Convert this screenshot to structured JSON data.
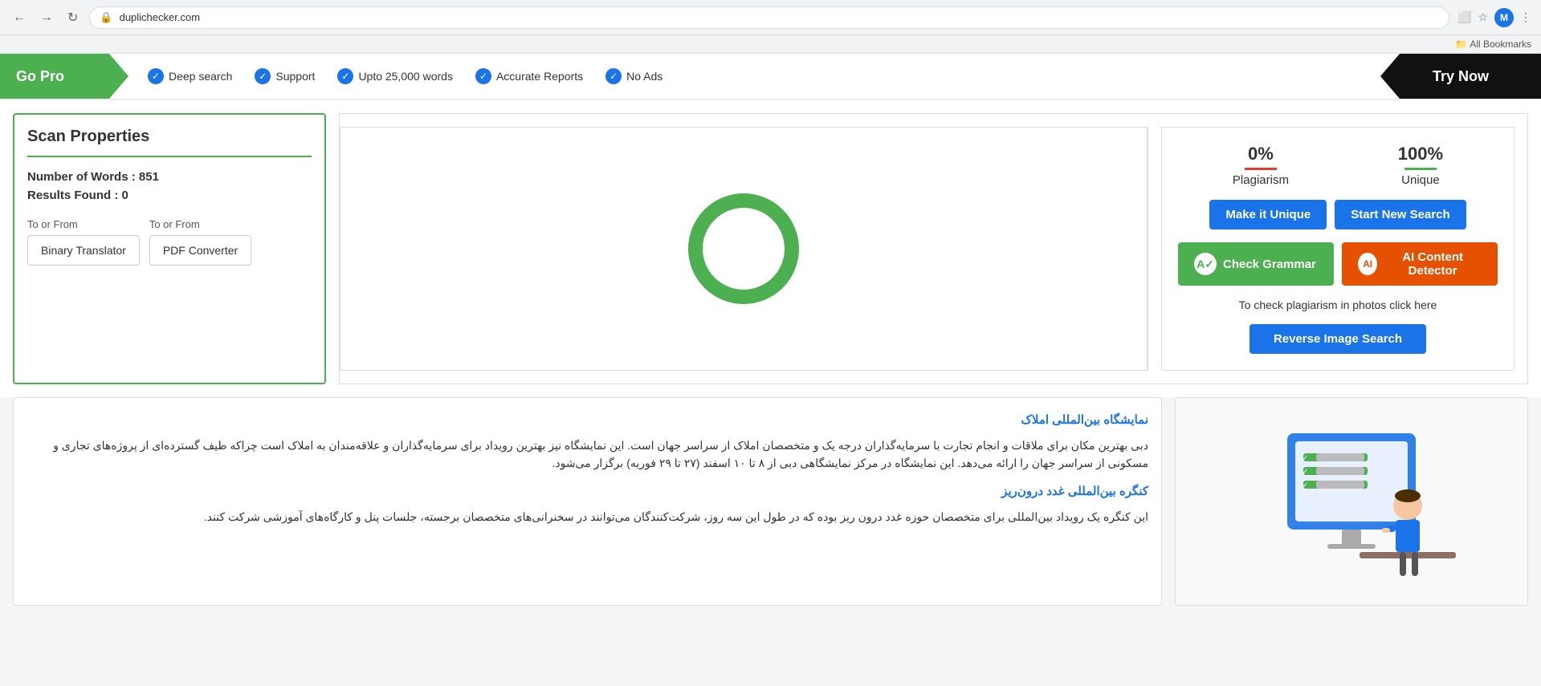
{
  "browser": {
    "url": "duplichecker.com",
    "bookmarks_bar": "All Bookmarks",
    "avatar_initial": "M"
  },
  "go_pro_banner": {
    "label": "Go Pro",
    "features": [
      {
        "icon": "check",
        "text": "Deep search"
      },
      {
        "icon": "check",
        "text": "Support"
      },
      {
        "icon": "check",
        "text": "Upto 25,000 words"
      },
      {
        "icon": "check",
        "text": "Accurate Reports"
      },
      {
        "icon": "check",
        "text": "No Ads"
      }
    ],
    "cta": "Try Now"
  },
  "scan_properties": {
    "title": "Scan Properties",
    "number_of_words_label": "Number of Words : ",
    "number_of_words_value": "851",
    "results_found_label": "Results Found : ",
    "results_found_value": "0",
    "converter1_label": "To or From",
    "converter1_text": "Binary Translator",
    "converter2_label": "To or From",
    "converter2_text": "PDF Converter"
  },
  "donut_chart": {
    "plagiarism_percent": 0,
    "unique_percent": 100,
    "stroke_color": "#4caf50",
    "track_color": "#e8e8e8"
  },
  "results_panel": {
    "plagiarism_percent": "0%",
    "plagiarism_label": "Plagiarism",
    "unique_percent": "100%",
    "unique_label": "Unique",
    "make_unique_label": "Make it Unique",
    "start_new_search_label": "Start New Search",
    "check_grammar_label": "Check Grammar",
    "ai_detector_label": "AI Content Detector",
    "plagiarism_photo_text": "To check plagiarism in photos click here",
    "reverse_image_search_label": "Reverse Image Search"
  },
  "text_content": {
    "section1_title": "نمایشگاه بین‌المللی املاک",
    "section1_body": "دبی بهترین مکان برای ملاقات و انجام تجارت با سرمایه‌گذاران درجه یک و متخصصان املاک از سراسر جهان است. این نمایشگاه نیز بهترین رویداد برای سرمایه‌گذاران و علاقه‌مندان به املاک است چراکه طیف گسترده‌ای از پروژه‌های تجاری و مسکونی از سراسر جهان را ارائه می‌دهد. این نمایشگاه در مرکز نمایشگاهی دبی از ۸ تا ۱۰ اسفند (۲۷ تا ۲۹ فوریه) برگزار می‌شود.",
    "section2_title": "کنگره بین‌المللی غدد درون‌ریز",
    "section2_body": "این کنگره یک رویداد بین‌المللی برای متخصصان حوزه غدد درون ریز بوده که در طول این سه روز، شرکت‌کنندگان می‌توانند در سخنرانی‌های متخصصان برجسته، جلسات پنل و کارگاه‌های آموزشی شرکت کنند."
  }
}
